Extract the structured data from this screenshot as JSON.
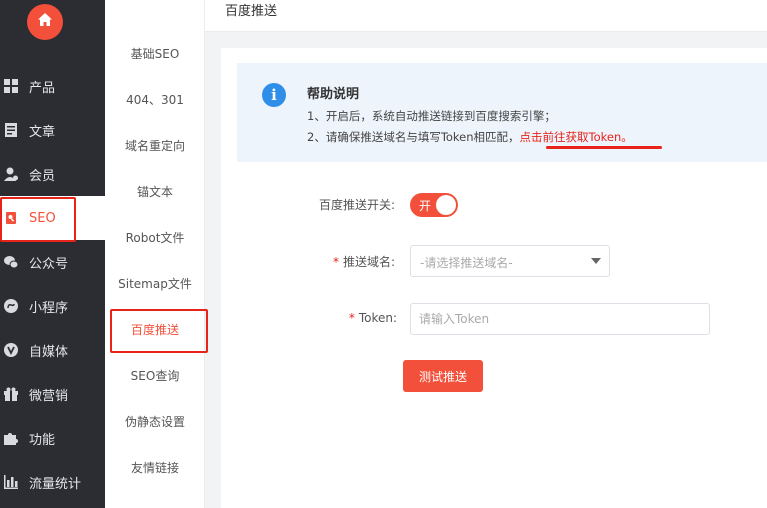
{
  "sidebar": {
    "logo_icon": "home-icon",
    "items": [
      {
        "label": "产品",
        "icon": "grid-icon"
      },
      {
        "label": "文章",
        "icon": "document-icon"
      },
      {
        "label": "会员",
        "icon": "user-icon"
      },
      {
        "label": "SEO",
        "icon": "seo-icon",
        "active": true
      },
      {
        "label": "公众号",
        "icon": "wechat-icon"
      },
      {
        "label": "小程序",
        "icon": "miniapp-icon"
      },
      {
        "label": "自媒体",
        "icon": "media-icon"
      },
      {
        "label": "微营销",
        "icon": "gift-icon"
      },
      {
        "label": "功能",
        "icon": "puzzle-icon"
      },
      {
        "label": "流量统计",
        "icon": "stats-icon"
      }
    ]
  },
  "submenu": {
    "items": [
      {
        "label": "基础SEO"
      },
      {
        "label": "404、301"
      },
      {
        "label": "域名重定向"
      },
      {
        "label": "锚文本"
      },
      {
        "label": "Robot文件"
      },
      {
        "label": "Sitemap文件"
      },
      {
        "label": "百度推送",
        "active": true
      },
      {
        "label": "SEO查询"
      },
      {
        "label": "伪静态设置"
      },
      {
        "label": "友情链接"
      }
    ]
  },
  "header": {
    "title": "百度推送"
  },
  "help": {
    "title": "帮助说明",
    "line1": "1、开启后，系统自动推送链接到百度搜索引擎；",
    "line2_prefix": "2、请确保推送域名与填写Token相匹配，",
    "line2_link": "点击前往获取Token",
    "line2_suffix": "。"
  },
  "form": {
    "switch_label": "百度推送开关:",
    "switch_on_text": "开",
    "switch_state": true,
    "domain_label": "推送域名:",
    "domain_placeholder": "-请选择推送域名-",
    "token_label": "Token:",
    "token_placeholder": "请输入Token",
    "required_mark": "*",
    "test_button": "测试推送"
  },
  "colors": {
    "accent": "#f2503a",
    "sidebar_bg": "#2b2d33",
    "info_blue": "#2f8ee8",
    "highlight": "#e8231a"
  }
}
